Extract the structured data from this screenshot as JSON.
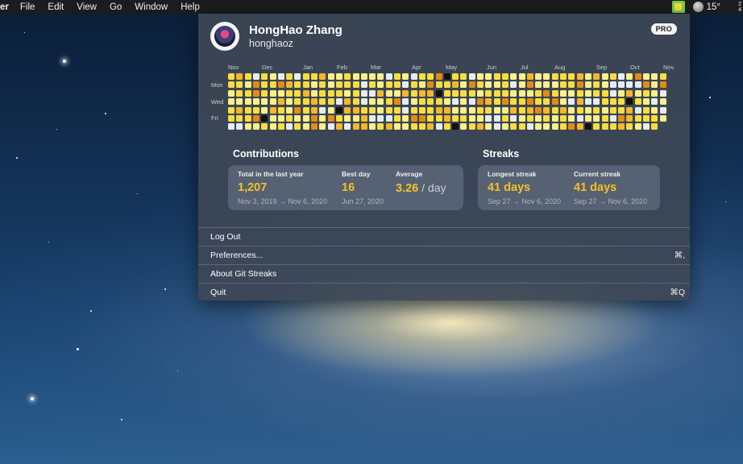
{
  "menubar": {
    "app_name": "er",
    "menus": [
      "File",
      "Edit",
      "View",
      "Go",
      "Window",
      "Help"
    ],
    "weather_temp": "15°",
    "clock_line1": "2",
    "clock_line2": "4"
  },
  "profile": {
    "name": "HongHao Zhang",
    "username": "honghaoz",
    "badge": "PRO"
  },
  "heatmap": {
    "months": [
      "Nov",
      "Dec",
      "Jan",
      "Feb",
      "Mar",
      "Apr",
      "May",
      "Jun",
      "Jul",
      "Aug",
      "Sep",
      "Oct",
      "Nov"
    ],
    "days": [
      "Mon",
      "Wed",
      "Fri"
    ],
    "weeks": 53,
    "colors": {
      "0": "#e6ecf5",
      "1": "#fdf08a",
      "2": "#f9dd3e",
      "3": "#f5b62a",
      "4": "#e58a14",
      "5": "#111111"
    }
  },
  "contributions": {
    "title": "Contributions",
    "total_label": "Total in the last year",
    "total_value": "1,207",
    "total_range": "Nov 3, 2019 → Nov 6, 2020",
    "best_label": "Best day",
    "best_value": "16",
    "best_date": "Jun 27, 2020",
    "avg_label": "Average",
    "avg_value": "3.26",
    "avg_unit": "/ day"
  },
  "streaks": {
    "title": "Streaks",
    "longest_label": "Longest streak",
    "longest_value": "41 days",
    "longest_range": "Sep 27 → Nov 6, 2020",
    "current_label": "Current streak",
    "current_value": "41 days",
    "current_range": "Sep 27 → Nov 6, 2020"
  },
  "menu": {
    "logout": "Log Out",
    "preferences": "Preferences...",
    "preferences_shortcut": "⌘,",
    "about": "About Git Streaks",
    "quit": "Quit",
    "quit_shortcut": "⌘Q"
  },
  "colors": {
    "accent": "#f5c026"
  }
}
